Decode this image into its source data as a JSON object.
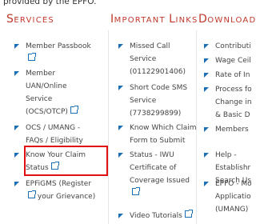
{
  "header_text": "provided by the EPFO.",
  "columns": [
    {
      "title_cap": "S",
      "title_rest": "ERVICES",
      "items": [
        {
          "lines": [
            "Member Passbook"
          ],
          "ext": true
        },
        {
          "lines": [
            "Member",
            "UAN/Online",
            "Service",
            "(OCS/OTCP)"
          ],
          "ext": true
        },
        {
          "lines": [
            "OCS / UMANG -",
            "FAQs / Eligibility"
          ],
          "ext": false
        },
        {
          "lines": [
            "Know Your Claim",
            "Status"
          ],
          "ext": true
        },
        {
          "lines": [
            "EPFiGMS (Register",
            "your Grievance)"
          ],
          "ext": true
        }
      ]
    },
    {
      "title_cap": "I",
      "title_rest": "MPORTANT ",
      "title_cap2": "L",
      "title_rest2": "INKS",
      "items": [
        {
          "lines": [
            "Missed Call",
            "Service",
            "(01122901406)"
          ],
          "ext": false
        },
        {
          "lines": [
            "Short Code SMS",
            "Service",
            "(7738299899)"
          ],
          "ext": false
        },
        {
          "lines": [
            "Know Which Claim",
            "Form to Submit"
          ],
          "ext": false
        },
        {
          "lines": [
            "Status - IWU",
            "Certificate of",
            "Coverage Issued"
          ],
          "ext": true
        },
        {
          "lines": [
            "Video Tutorials"
          ],
          "ext": true
        }
      ]
    },
    {
      "title_cap": "D",
      "title_rest": "OWNLOADS",
      "items": [
        {
          "lines": [
            "Contributi"
          ],
          "ext": false
        },
        {
          "lines": [
            "Wage Ceil"
          ],
          "ext": false
        },
        {
          "lines": [
            "Rate of In"
          ],
          "ext": false
        },
        {
          "lines": [
            "Process fo",
            "Change in",
            "& Basic D"
          ],
          "ext": false
        },
        {
          "lines": [
            "Members"
          ],
          "ext": false
        },
        {
          "lines": [
            "Help -",
            "Establishr",
            "Search Us"
          ],
          "ext": false
        },
        {
          "lines": [
            "EPFO - Mo",
            "Applicatio",
            "(UMANG)"
          ],
          "ext": false
        }
      ]
    }
  ]
}
